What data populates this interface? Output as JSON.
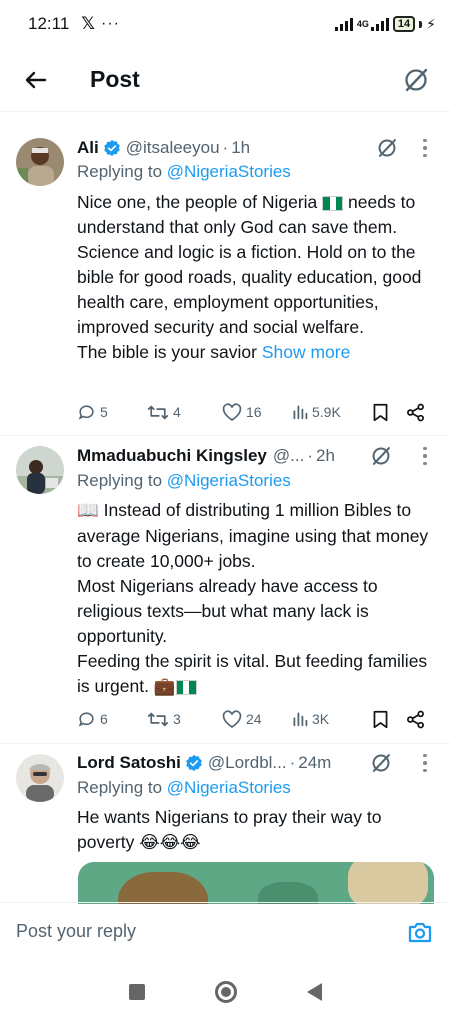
{
  "status_bar": {
    "time": "12:11",
    "x_logo": "𝕏",
    "more_dots": "···",
    "network": "4G",
    "battery": "14"
  },
  "header": {
    "title": "Post",
    "back_icon": "arrow-left-icon",
    "grok_icon": "grok-icon"
  },
  "tweets": [
    {
      "name": "Ali",
      "verified": true,
      "handle": "@itsaleeyou",
      "separator": "·",
      "time": "1h",
      "replying_prefix": "Replying to ",
      "replying_to": "@NigeriaStories",
      "text_lines": [
        "Nice one, the people of Nigeria",
        " needs to understand that only God can save them. Science and logic is a fiction. Hold on to the bible for good roads, quality education, good health care, employment opportunities, improved security and social welfare.",
        "The bible is your savior "
      ],
      "show_more": "Show more",
      "replies": "5",
      "reposts": "4",
      "likes": "16",
      "views": "5.9K"
    },
    {
      "name": "Mmaduabuchi Kingsley",
      "verified": false,
      "handle": "@...",
      "separator": "·",
      "time": "2h",
      "replying_prefix": "Replying to ",
      "replying_to": "@NigeriaStories",
      "book_emoji": "📖",
      "text_lines": [
        " Instead of distributing 1 million Bibles to average Nigerians, imagine using that money to create 10,000+ jobs.",
        "Most Nigerians already have access to religious texts—but what many lack is opportunity.",
        "Feeding the spirit is vital. But feeding families is urgent. "
      ],
      "briefcase_emoji": "💼",
      "replies": "6",
      "reposts": "3",
      "likes": "24",
      "views": "3K"
    },
    {
      "name": "Lord Satoshi",
      "verified": true,
      "handle": "@Lordbl...",
      "separator": "·",
      "time": "24m",
      "replying_prefix": "Replying to ",
      "replying_to": "@NigeriaStories",
      "text_lines": [
        "He wants Nigerians to  pray their way to poverty "
      ],
      "laugh_emojis": "😂😂😂"
    }
  ],
  "composer": {
    "placeholder": "Post your reply",
    "camera_icon": "camera-icon"
  },
  "colors": {
    "accent": "#1d9bf0",
    "secondary_text": "#536471",
    "primary_text": "#0f1419",
    "flag_green": "#008751"
  }
}
